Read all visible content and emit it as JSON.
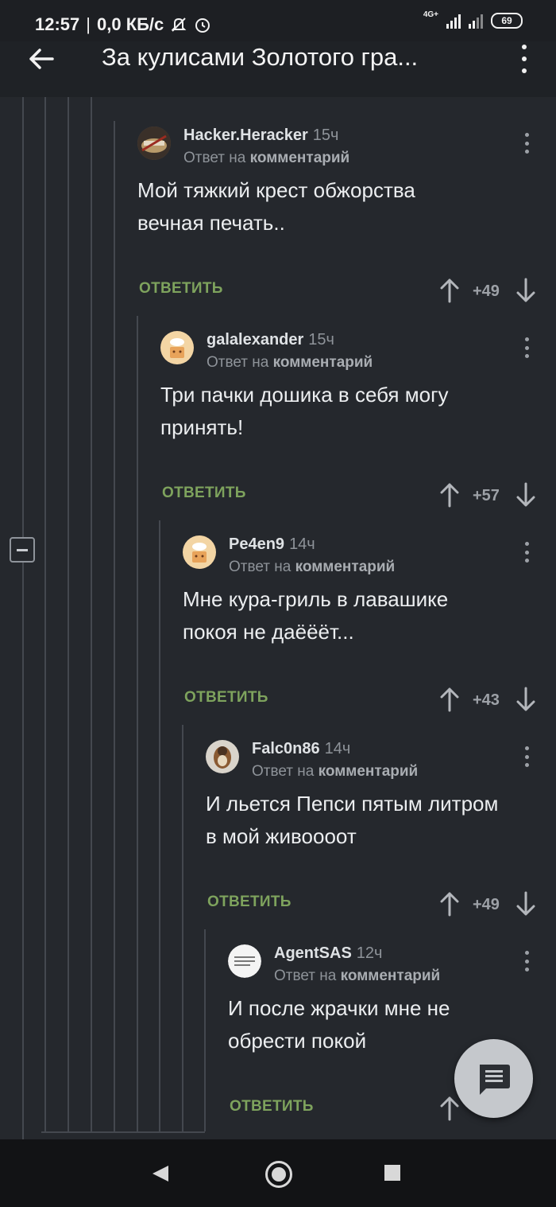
{
  "status_bar": {
    "time": "12:57",
    "speed": "0,0 КБ/с",
    "network_type": "4G+",
    "battery": "69"
  },
  "app_bar": {
    "title": "За кулисами Золотого гра..."
  },
  "labels": {
    "reply_to_prefix": "Ответ на",
    "reply_to_target": "комментарий",
    "reply_action": "ОТВЕТИТЬ"
  },
  "comments": [
    {
      "author": "Hacker.Heracker",
      "time": "15ч",
      "line1": "Мой тяжкий крест обжорства",
      "line2": "вечная печать..",
      "score": "+49",
      "avatar": "avatar-image"
    },
    {
      "author": "galalexander",
      "time": "15ч",
      "line1": "Три пачки дошика в себя могу",
      "line2": "принять!",
      "score": "+57",
      "avatar": "default-avatar"
    },
    {
      "author": "Pe4en9",
      "time": "14ч",
      "line1": "Мне кура-гриль в лавашике",
      "line2": "покоя не даёёёт...",
      "score": "+43",
      "avatar": "default-avatar"
    },
    {
      "author": "Falc0n86",
      "time": "14ч",
      "line1": "И льется Пепси пятым литром",
      "line2": "в мой живоооот",
      "score": "+49",
      "avatar": "avatar-image"
    },
    {
      "author": "AgentSAS",
      "time": "12ч",
      "line1": "И после жрачки мне не",
      "line2": "обрести покой",
      "score": "",
      "avatar": "lines-avatar"
    }
  ],
  "colors": {
    "background": "#25282d",
    "reply_action": "#7ea35d",
    "thread_line": "#44484f",
    "fab": "#c5c8cc"
  }
}
